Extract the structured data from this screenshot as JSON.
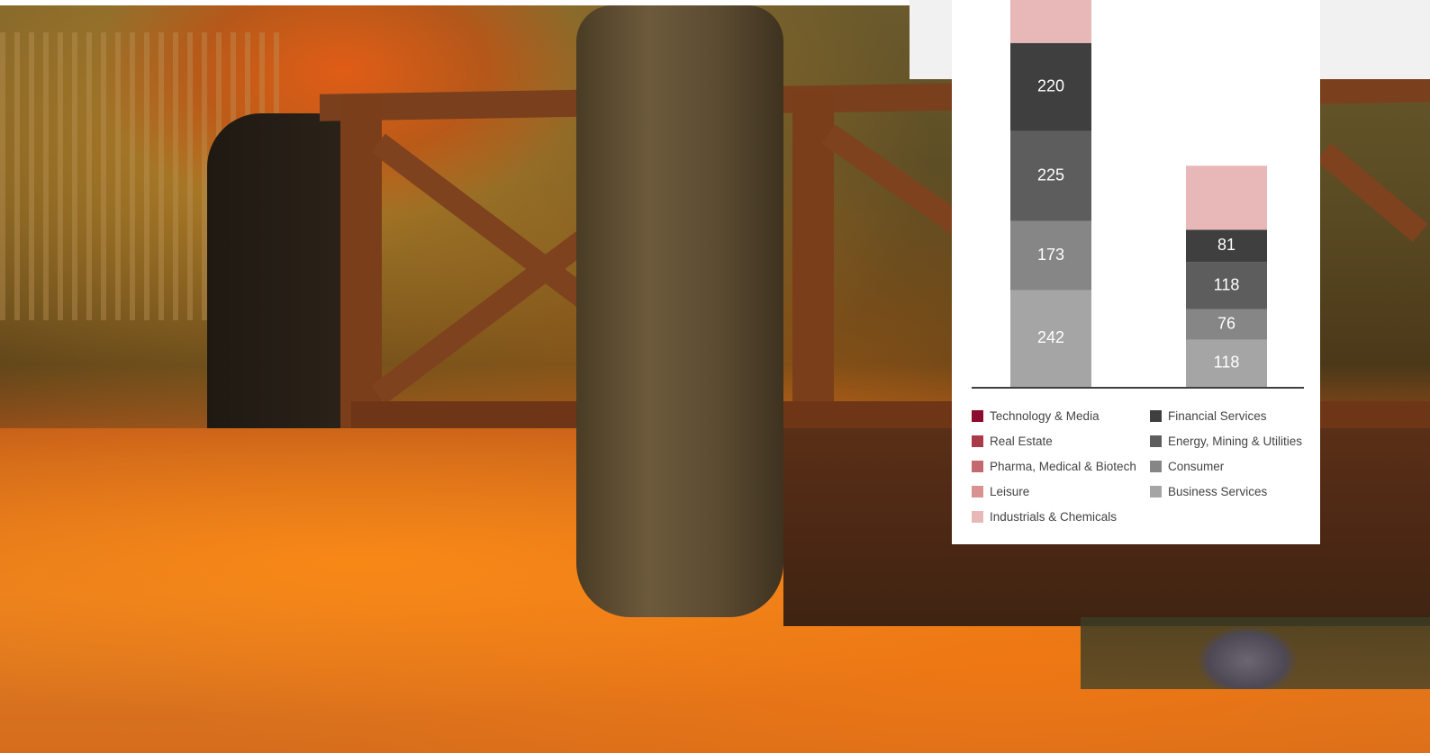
{
  "legend": [
    {
      "name": "Technology & Media",
      "color": "#8c0c2e"
    },
    {
      "name": "Financial Services",
      "color": "#3f3f3f"
    },
    {
      "name": "Real Estate",
      "color": "#a93a4a"
    },
    {
      "name": "Energy, Mining & Utilities",
      "color": "#5d5d5d"
    },
    {
      "name": "Pharma, Medical & Biotech",
      "color": "#c36a6e"
    },
    {
      "name": "Consumer",
      "color": "#868686"
    },
    {
      "name": "Leisure",
      "color": "#d99292"
    },
    {
      "name": "Business Services",
      "color": "#a5a5a5"
    },
    {
      "name": "Industrials & Chemicals",
      "color": "#e8b8b8"
    }
  ],
  "chart_data": {
    "type": "bar",
    "stacked": true,
    "categories": [
      "",
      ""
    ],
    "series": [
      {
        "name": "Business Services",
        "color": "#a5a5a5",
        "values": [
          242,
          118
        ]
      },
      {
        "name": "Consumer",
        "color": "#868686",
        "values": [
          173,
          76
        ]
      },
      {
        "name": "Energy, Mining & Utilities",
        "color": "#5d5d5d",
        "values": [
          225,
          118
        ]
      },
      {
        "name": "Financial Services",
        "color": "#3f3f3f",
        "values": [
          220,
          81
        ]
      },
      {
        "name": "Industrials & Chemicals",
        "color": "#e8b8b8",
        "values": [
          null,
          160
        ]
      }
    ],
    "visible_top": [
      null,
      null
    ],
    "grid": false,
    "legend_position": "bottom"
  }
}
